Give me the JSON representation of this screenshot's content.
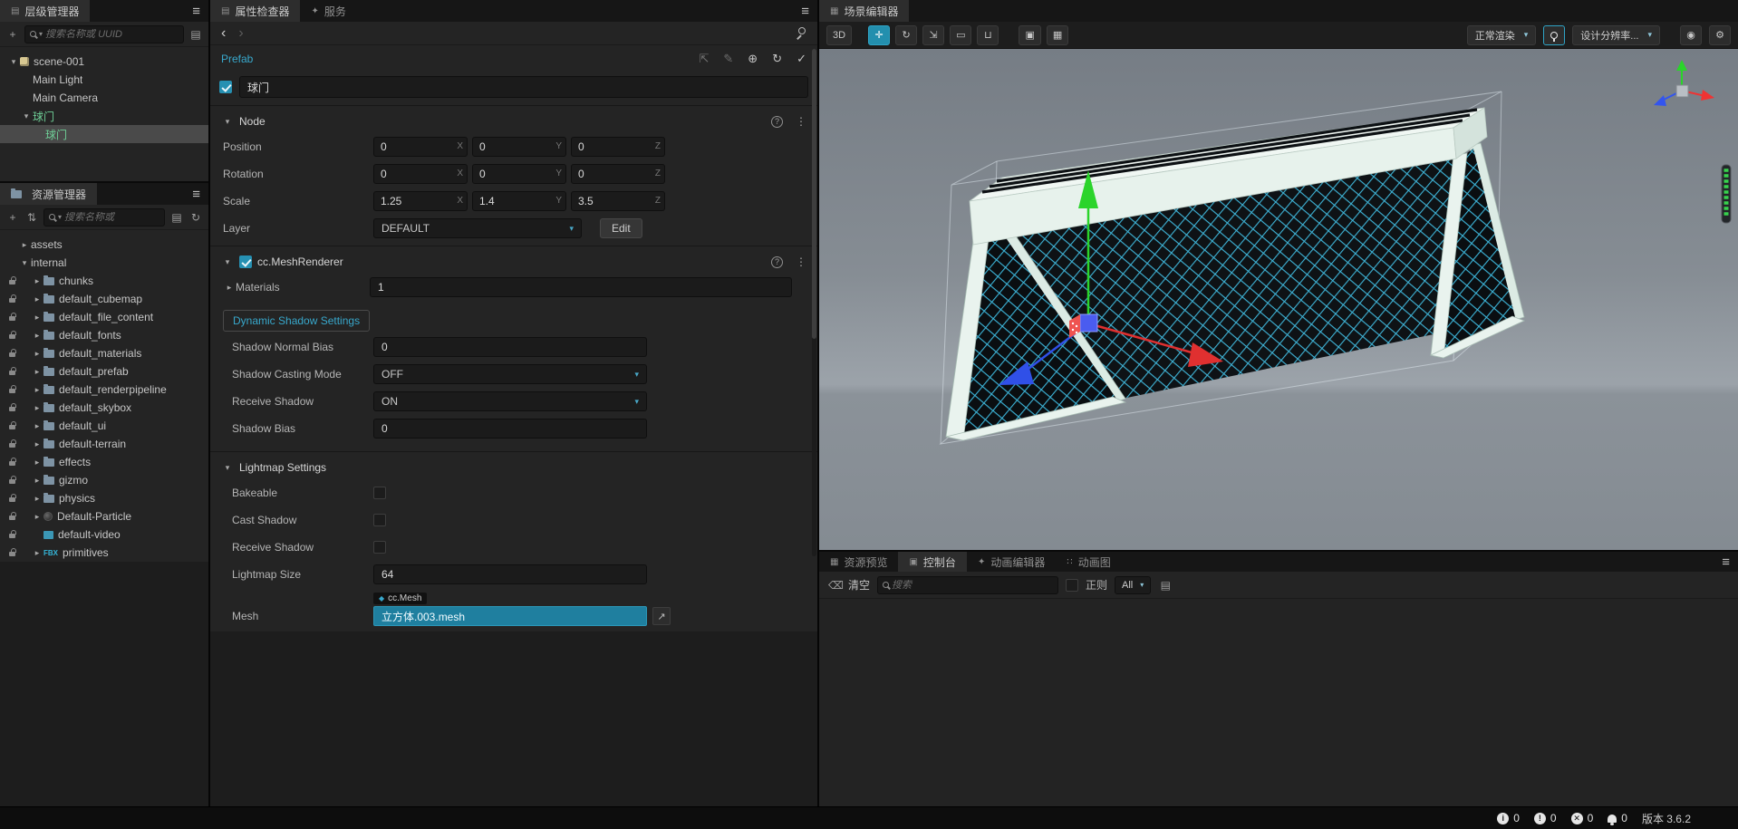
{
  "colors": {
    "accent": "#38a8cc",
    "prefab_node": "#6fcf97",
    "checkbox_checked": "#2690b2",
    "mesh_field": "#1f7f9f",
    "gizmo_x": "#e03030",
    "gizmo_y": "#2bd42b",
    "gizmo_z": "#3050e8",
    "net_line": "#3cb4d8"
  },
  "icons": {
    "hamburger": "≡",
    "kebab": "⋮",
    "chevron_down": "▾",
    "chevron_right": "▸",
    "back": "‹",
    "forward": "›",
    "plus": "+",
    "sort": "⇅",
    "list": "▤",
    "grid": "▦",
    "refresh": "↻",
    "question": "?",
    "check": "✓",
    "search_caret": "▾",
    "diamond": "◆",
    "pick": "↗",
    "clear": "⌫",
    "doc": "▤"
  },
  "hierarchy": {
    "tab": {
      "label": "层级管理器",
      "glyph": "▤"
    },
    "search_placeholder": "搜索名称或 UUID",
    "nodes": [
      {
        "label": "scene-001",
        "depth": 0,
        "arrow": "expanded",
        "icon": "scene"
      },
      {
        "label": "Main Light",
        "depth": 1,
        "arrow": "none"
      },
      {
        "label": "Main Camera",
        "depth": 1,
        "arrow": "none"
      },
      {
        "label": "球门",
        "depth": 1,
        "arrow": "expanded",
        "color": "prefab"
      },
      {
        "label": "球门",
        "depth": 2,
        "arrow": "none",
        "color": "prefab",
        "selected": true
      }
    ]
  },
  "assets": {
    "tab": {
      "label": "资源管理器"
    },
    "search_placeholder": "搜索名称或",
    "nodes": [
      {
        "label": "assets",
        "depth": 0,
        "arrow": "collapsed"
      },
      {
        "label": "internal",
        "depth": 0,
        "arrow": "expanded"
      },
      {
        "label": "chunks",
        "depth": 1,
        "arrow": "collapsed",
        "locked": true,
        "icon": "folder"
      },
      {
        "label": "default_cubemap",
        "depth": 1,
        "arrow": "collapsed",
        "locked": true,
        "icon": "folder"
      },
      {
        "label": "default_file_content",
        "depth": 1,
        "arrow": "collapsed",
        "locked": true,
        "icon": "folder"
      },
      {
        "label": "default_fonts",
        "depth": 1,
        "arrow": "collapsed",
        "locked": true,
        "icon": "folder"
      },
      {
        "label": "default_materials",
        "depth": 1,
        "arrow": "collapsed",
        "locked": true,
        "icon": "folder"
      },
      {
        "label": "default_prefab",
        "depth": 1,
        "arrow": "collapsed",
        "locked": true,
        "icon": "folder"
      },
      {
        "label": "default_renderpipeline",
        "depth": 1,
        "arrow": "collapsed",
        "locked": true,
        "icon": "folder"
      },
      {
        "label": "default_skybox",
        "depth": 1,
        "arrow": "collapsed",
        "locked": true,
        "icon": "folder"
      },
      {
        "label": "default_ui",
        "depth": 1,
        "arrow": "collapsed",
        "locked": true,
        "icon": "folder"
      },
      {
        "label": "default-terrain",
        "depth": 1,
        "arrow": "collapsed",
        "locked": true,
        "icon": "folder"
      },
      {
        "label": "effects",
        "depth": 1,
        "arrow": "collapsed",
        "locked": true,
        "icon": "folder"
      },
      {
        "label": "gizmo",
        "depth": 1,
        "arrow": "collapsed",
        "locked": true,
        "icon": "folder"
      },
      {
        "label": "physics",
        "depth": 1,
        "arrow": "collapsed",
        "locked": true,
        "icon": "folder"
      },
      {
        "label": "Default-Particle",
        "depth": 1,
        "arrow": "collapsed",
        "locked": true,
        "icon": "particle"
      },
      {
        "label": "default-video",
        "depth": 1,
        "arrow": "none",
        "locked": true,
        "icon": "video"
      },
      {
        "label": "primitives",
        "depth": 1,
        "arrow": "collapsed",
        "locked": true,
        "icon": "fbx",
        "icon_label": "FBX"
      }
    ]
  },
  "inspector": {
    "tabs": [
      {
        "label": "属性检查器",
        "glyph": "▤",
        "active": true
      },
      {
        "label": "服务",
        "glyph": "✦",
        "active": false
      }
    ],
    "prefab": {
      "label": "Prefab",
      "buttons": [
        {
          "glyph": "⇱"
        },
        {
          "glyph": "✎"
        },
        {
          "glyph": "⊕"
        },
        {
          "glyph": "↻"
        },
        {
          "glyph": "✓"
        }
      ]
    },
    "name": {
      "value": "球门",
      "checked": true
    },
    "axes": [
      "X",
      "Y",
      "Z"
    ],
    "node": {
      "title": "Node",
      "position": {
        "label": "Position",
        "x": "0",
        "y": "0",
        "z": "0"
      },
      "rotation": {
        "label": "Rotation",
        "x": "0",
        "y": "0",
        "z": "0"
      },
      "scale": {
        "label": "Scale",
        "x": "1.25",
        "y": "1.4",
        "z": "3.5"
      },
      "layer": {
        "label": "Layer",
        "value": "DEFAULT",
        "edit": "Edit"
      }
    },
    "renderer": {
      "title": "cc.MeshRenderer",
      "materials": {
        "label": "Materials",
        "value": "1"
      },
      "shadow_tab": "Dynamic Shadow Settings",
      "shadow_rows": [
        {
          "label": "Shadow Normal Bias",
          "value": "0",
          "control": "input"
        },
        {
          "label": "Shadow Casting Mode",
          "value": "OFF",
          "control": "select"
        },
        {
          "label": "Receive Shadow",
          "value": "ON",
          "control": "select"
        },
        {
          "label": "Shadow Bias",
          "value": "0",
          "control": "input"
        }
      ],
      "lightmap": {
        "title": "Lightmap Settings",
        "bakeable": "Bakeable",
        "cast_shadow": "Cast Shadow",
        "receive_shadow": "Receive Shadow",
        "size": {
          "label": "Lightmap Size",
          "value": "64"
        }
      },
      "mesh": {
        "label": "Mesh",
        "chip": "cc.Mesh",
        "value": "立方体.003.mesh"
      }
    }
  },
  "scene": {
    "tab": {
      "label": "场景编辑器",
      "glyph": "▦"
    },
    "toolbar": {
      "mode": "3D",
      "tools": [
        {
          "name": "move",
          "glyph": "✛",
          "active": true
        },
        {
          "name": "rotate",
          "glyph": "↻",
          "active": false
        },
        {
          "name": "scale",
          "glyph": "⇲",
          "active": false
        },
        {
          "name": "rect",
          "glyph": "▭",
          "active": false
        },
        {
          "name": "snap",
          "glyph": "⊔",
          "active": false
        }
      ],
      "extra": [
        {
          "name": "pivot",
          "glyph": "▣"
        },
        {
          "name": "coords",
          "glyph": "▦"
        }
      ],
      "render_mode": "正常渲染",
      "resolution": "设计分辨率...",
      "right_icons": [
        {
          "name": "capture",
          "glyph": "◉"
        },
        {
          "name": "settings",
          "glyph": "⚙"
        }
      ]
    }
  },
  "console": {
    "tabs": [
      {
        "label": "资源预览",
        "glyph": "▦",
        "active": false
      },
      {
        "label": "控制台",
        "glyph": "▣",
        "active": true
      },
      {
        "label": "动画编辑器",
        "glyph": "✦",
        "active": false
      },
      {
        "label": "动画图",
        "glyph": "∷",
        "active": false
      }
    ],
    "toolbar": {
      "clear": "清空",
      "search_placeholder": "搜索",
      "regex": "正则",
      "filter": "All"
    }
  },
  "statusbar": {
    "items": [
      {
        "name": "info",
        "glyph": "i",
        "count": "0"
      },
      {
        "name": "log",
        "glyph": "!",
        "count": "0"
      },
      {
        "name": "error",
        "glyph": "✕",
        "count": "0"
      },
      {
        "name": "notify",
        "glyph": "",
        "count": "0"
      }
    ],
    "version": "版本 3.6.2"
  }
}
